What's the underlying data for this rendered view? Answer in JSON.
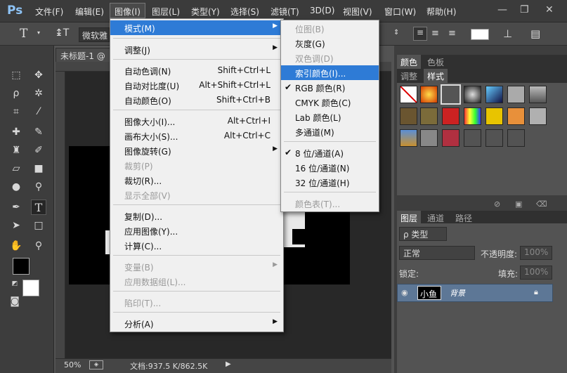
{
  "app": {
    "logo": "Ps"
  },
  "menubar": {
    "items": [
      "文件(F)",
      "编辑(E)",
      "图像(I)",
      "图层(L)",
      "类型(Y)",
      "选择(S)",
      "滤镜(T)",
      "3D(D)",
      "视图(V)",
      "窗口(W)",
      "帮助(H)"
    ],
    "active": "图像(I)"
  },
  "options_bar": {
    "font_family_value": "微软雅"
  },
  "document": {
    "tab_title": "未标题-1 @",
    "zoom": "50%",
    "doc_size": "文档:937.5 K/862.5K"
  },
  "image_menu": {
    "items": [
      {
        "label": "模式(M)",
        "shortcut": "",
        "submenu": true,
        "disabled": false,
        "highlighted": true
      },
      {
        "label": "调整(J)",
        "shortcut": "",
        "submenu": true,
        "disabled": false
      },
      {
        "label": "自动色调(N)",
        "shortcut": "Shift+Ctrl+L",
        "submenu": false,
        "disabled": false
      },
      {
        "label": "自动对比度(U)",
        "shortcut": "Alt+Shift+Ctrl+L",
        "submenu": false,
        "disabled": false
      },
      {
        "label": "自动颜色(O)",
        "shortcut": "Shift+Ctrl+B",
        "submenu": false,
        "disabled": false
      },
      {
        "label": "图像大小(I)...",
        "shortcut": "Alt+Ctrl+I",
        "submenu": false,
        "disabled": false
      },
      {
        "label": "画布大小(S)...",
        "shortcut": "Alt+Ctrl+C",
        "submenu": false,
        "disabled": false
      },
      {
        "label": "图像旋转(G)",
        "shortcut": "",
        "submenu": true,
        "disabled": false
      },
      {
        "label": "裁剪(P)",
        "shortcut": "",
        "submenu": false,
        "disabled": true
      },
      {
        "label": "裁切(R)...",
        "shortcut": "",
        "submenu": false,
        "disabled": false
      },
      {
        "label": "显示全部(V)",
        "shortcut": "",
        "submenu": false,
        "disabled": true
      },
      {
        "label": "复制(D)...",
        "shortcut": "",
        "submenu": false,
        "disabled": false
      },
      {
        "label": "应用图像(Y)...",
        "shortcut": "",
        "submenu": false,
        "disabled": false
      },
      {
        "label": "计算(C)...",
        "shortcut": "",
        "submenu": false,
        "disabled": false
      },
      {
        "label": "变量(B)",
        "shortcut": "",
        "submenu": true,
        "disabled": true
      },
      {
        "label": "应用数据组(L)...",
        "shortcut": "",
        "submenu": false,
        "disabled": true
      },
      {
        "label": "陷印(T)...",
        "shortcut": "",
        "submenu": false,
        "disabled": true
      },
      {
        "label": "分析(A)",
        "shortcut": "",
        "submenu": true,
        "disabled": false
      }
    ]
  },
  "mode_menu": {
    "items": [
      {
        "label": "位图(B)",
        "checked": false,
        "disabled": true
      },
      {
        "label": "灰度(G)",
        "checked": false,
        "disabled": false
      },
      {
        "label": "双色调(D)",
        "checked": false,
        "disabled": true
      },
      {
        "label": "索引颜色(I)...",
        "checked": false,
        "disabled": false,
        "highlighted": true
      },
      {
        "label": "RGB 颜色(R)",
        "checked": true,
        "disabled": false
      },
      {
        "label": "CMYK 颜色(C)",
        "checked": false,
        "disabled": false
      },
      {
        "label": "Lab 颜色(L)",
        "checked": false,
        "disabled": false
      },
      {
        "label": "多通道(M)",
        "checked": false,
        "disabled": false
      },
      {
        "label": "8 位/通道(A)",
        "checked": true,
        "disabled": false
      },
      {
        "label": "16 位/通道(N)",
        "checked": false,
        "disabled": false
      },
      {
        "label": "32 位/通道(H)",
        "checked": false,
        "disabled": false
      },
      {
        "label": "颜色表(T)...",
        "checked": false,
        "disabled": true
      }
    ]
  },
  "color_panel": {
    "tabs": [
      "颜色",
      "色板"
    ],
    "active": "颜色"
  },
  "styles_panel": {
    "tabs": [
      "调整",
      "样式"
    ],
    "active": "样式"
  },
  "layers_panel": {
    "tabs": [
      "图层",
      "通道",
      "路径"
    ],
    "active": "图层",
    "filter_label": "ρ 类型",
    "blend_mode": "正常",
    "opacity_label": "不透明度:",
    "opacity_value": "100%",
    "lock_label": "锁定:",
    "fill_label": "填充:",
    "fill_value": "100%",
    "layer": {
      "thumb_text": "小鱼",
      "name": "背景"
    }
  },
  "colors": {
    "menu_highlight": "#2e7bd6",
    "layer_selected": "#5d7796",
    "foreground": "#000000",
    "background": "#ffffff"
  }
}
